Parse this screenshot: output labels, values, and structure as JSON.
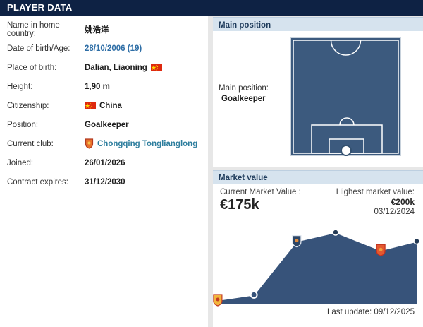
{
  "page": {
    "title": "PLAYER DATA"
  },
  "player_data": {
    "rows": [
      {
        "label": "Name in home country:",
        "value": "姚浩洋"
      },
      {
        "label": "Date of birth/Age:",
        "value": "28/10/2006 (19)"
      },
      {
        "label": "Place of birth:",
        "value": "Dalian, Liaoning"
      },
      {
        "label": "Height:",
        "value": "1,90 m"
      },
      {
        "label": "Citizenship:",
        "value": "China"
      },
      {
        "label": "Position:",
        "value": "Goalkeeper"
      },
      {
        "label": "Current club:",
        "value": "Chongqing Tonglianglong"
      },
      {
        "label": "Joined:",
        "value": "26/01/2026"
      },
      {
        "label": "Contract expires:",
        "value": "31/12/2030"
      }
    ]
  },
  "main_position": {
    "header": "Main position",
    "label": "Main position:",
    "value": "Goalkeeper"
  },
  "market_value": {
    "header": "Market value",
    "current_label": "Current Market Value :",
    "current_value": "€175k",
    "highest_label": "Highest market value:",
    "highest_value": "€200k",
    "highest_date": "03/12/2024",
    "last_update": "Last update: 09/12/2025"
  },
  "chart_data": {
    "type": "area",
    "title": "Market value",
    "unit": "€k",
    "ylim_k": [
      0,
      200
    ],
    "grid": false,
    "legend": false,
    "values_k": [
      10,
      25,
      175,
      200,
      150,
      175
    ],
    "points": [
      {
        "value_k": 10,
        "x_frac": 0.023,
        "marker": "club-badge",
        "fill": "#f2b63c",
        "stroke": "#c43b23",
        "inner": "#c43b23"
      },
      {
        "value_k": 25,
        "x_frac": 0.195,
        "marker": "ring",
        "fill": "#37537a",
        "stroke": "#ffffff"
      },
      {
        "value_k": 175,
        "x_frac": 0.399,
        "marker": "club-badge",
        "fill": "#2c4566",
        "stroke": "#dfe6ef",
        "inner": "#e08a3c"
      },
      {
        "value_k": 200,
        "x_frac": 0.584,
        "marker": "dot",
        "fill": "#243a55",
        "stroke": "#ffffff"
      },
      {
        "value_k": 150,
        "x_frac": 0.799,
        "marker": "club-badge",
        "fill": "#e4582f",
        "stroke": "#c0321f",
        "inner": "#f0a03e"
      },
      {
        "value_k": 175,
        "x_frac": 0.97,
        "marker": "dot",
        "fill": "#243a55",
        "stroke": "#ffffff"
      }
    ],
    "area_color": "#37537a",
    "line_color": "#ffffff"
  },
  "colors": {
    "header_bar": "#0e2244",
    "panel_header_bg": "#d6e3ee",
    "pitch": "#3c5a7e",
    "link_blue": "#2e6ea6",
    "link_teal": "#2e7e9e"
  }
}
